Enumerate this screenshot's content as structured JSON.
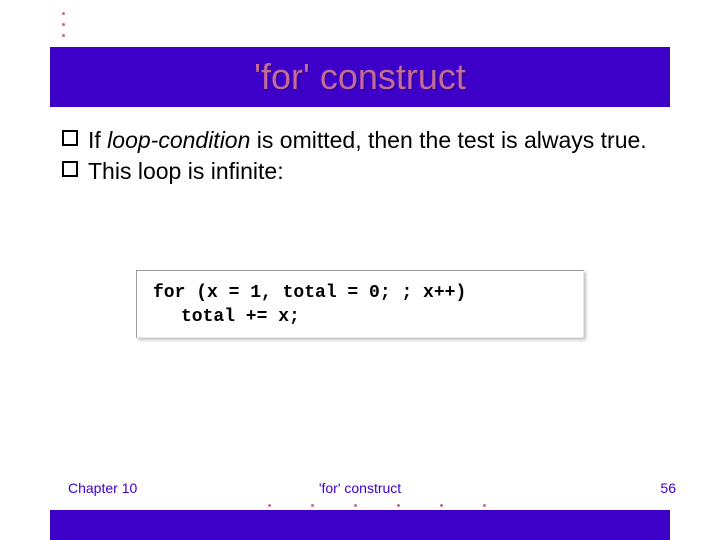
{
  "title": "'for' construct",
  "bullets": {
    "b1_pre": "If ",
    "b1_em": "loop-condition",
    "b1_post": " is omitted, then the test is always true.",
    "b2": "This loop is infinite:"
  },
  "code": {
    "line1": "for (x = 1, total = 0; ; x++)",
    "line2": "total += x;"
  },
  "footer": {
    "left": "Chapter 10",
    "center": "'for' construct",
    "right": "56"
  }
}
